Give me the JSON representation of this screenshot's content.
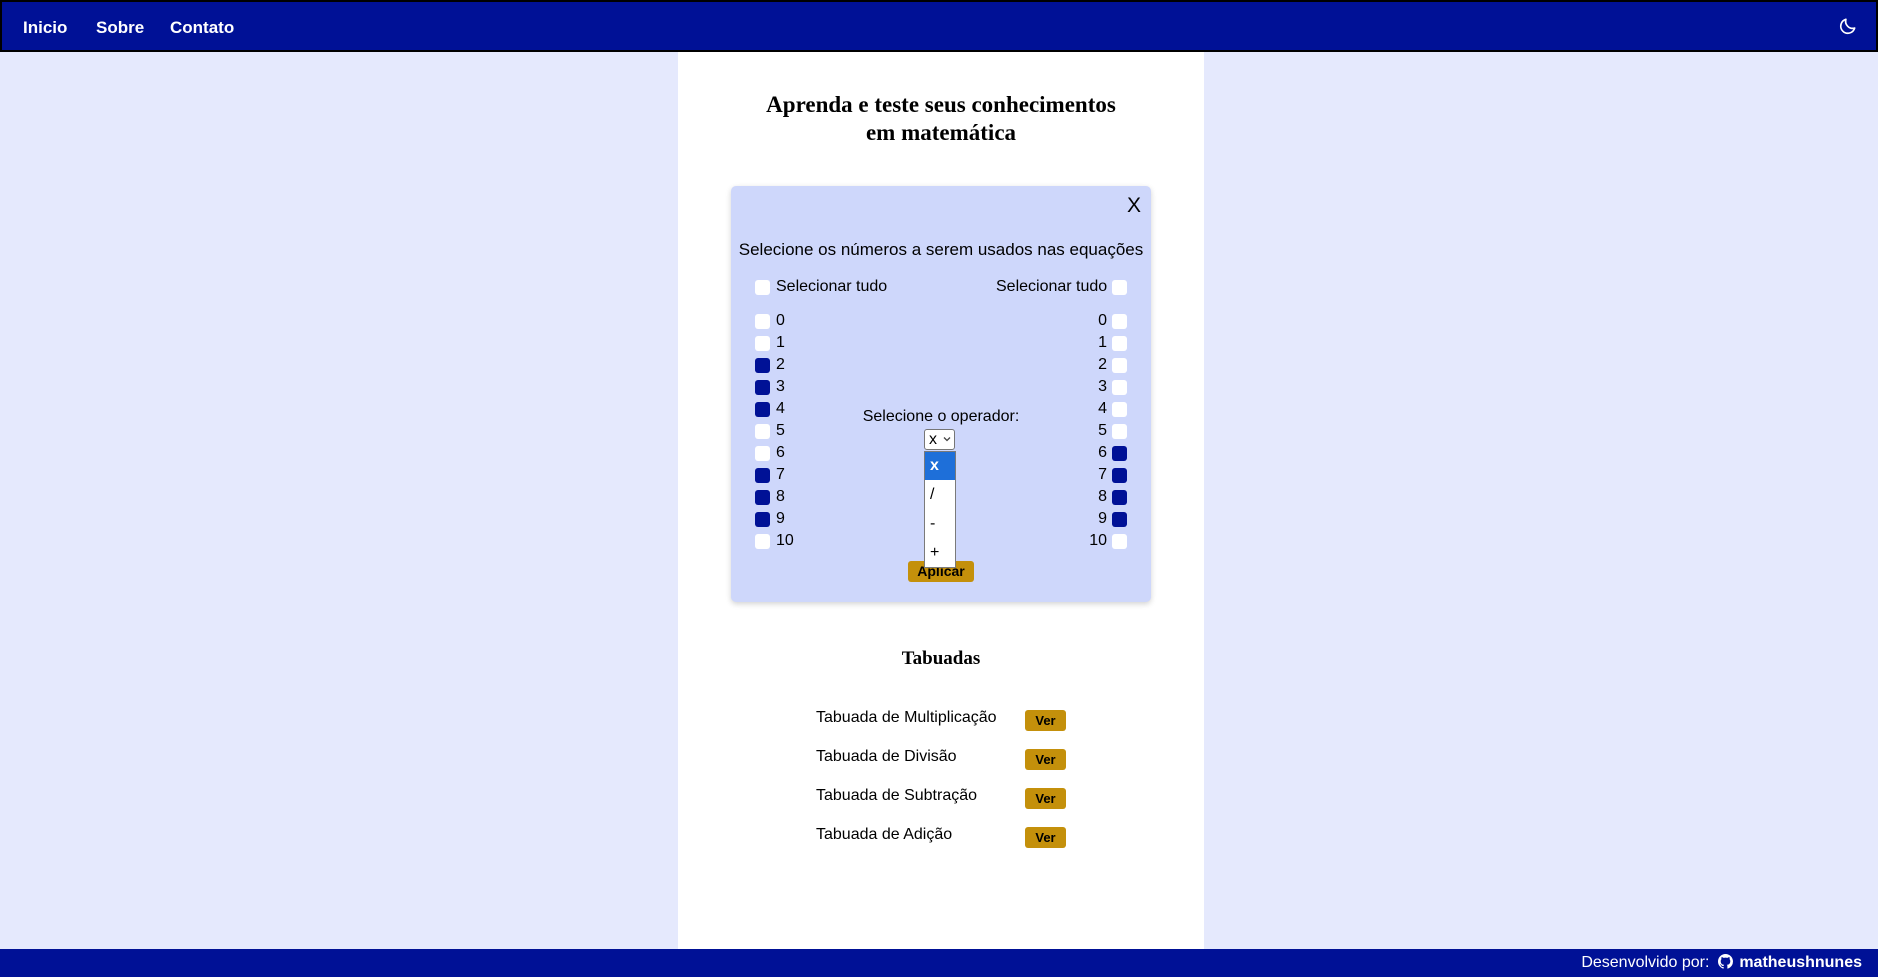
{
  "nav": {
    "links": [
      "Inicio",
      "Sobre",
      "Contato"
    ],
    "theme_icon": "moon-icon"
  },
  "header": {
    "title_line1": "Aprenda e teste seus conhecimentos",
    "title_line2": "em matemática"
  },
  "modal": {
    "close_label": "X",
    "instruction": "Selecione os números a serem usados nas equações",
    "select_all_left": "Selecionar tudo",
    "select_all_right": "Selecionar tudo",
    "numbers": [
      "0",
      "1",
      "2",
      "3",
      "4",
      "5",
      "6",
      "7",
      "8",
      "9",
      "10"
    ],
    "left_checked": [
      false,
      false,
      true,
      true,
      true,
      false,
      false,
      true,
      true,
      true,
      false
    ],
    "right_checked": [
      false,
      false,
      false,
      false,
      false,
      false,
      true,
      true,
      true,
      true,
      false
    ],
    "operator_label": "Selecione o operador:",
    "operator_value": "x",
    "operator_options": [
      "x",
      "/",
      "-",
      "+"
    ],
    "apply_label": "Aplicar"
  },
  "tabuadas": {
    "title": "Tabuadas",
    "items": [
      {
        "label": "Tabuada de Multiplicação",
        "button": "Ver"
      },
      {
        "label": "Tabuada de Divisão",
        "button": "Ver"
      },
      {
        "label": "Tabuada de Subtração",
        "button": "Ver"
      },
      {
        "label": "Tabuada de Adição",
        "button": "Ver"
      }
    ]
  },
  "footer": {
    "prefix": "Desenvolvido por:",
    "username": "matheushnunes",
    "icon": "github-icon"
  },
  "colors": {
    "primary": "#001196",
    "accent": "#c4900b",
    "modal_bg": "#ced7fb",
    "page_bg": "#e5e9fd"
  }
}
